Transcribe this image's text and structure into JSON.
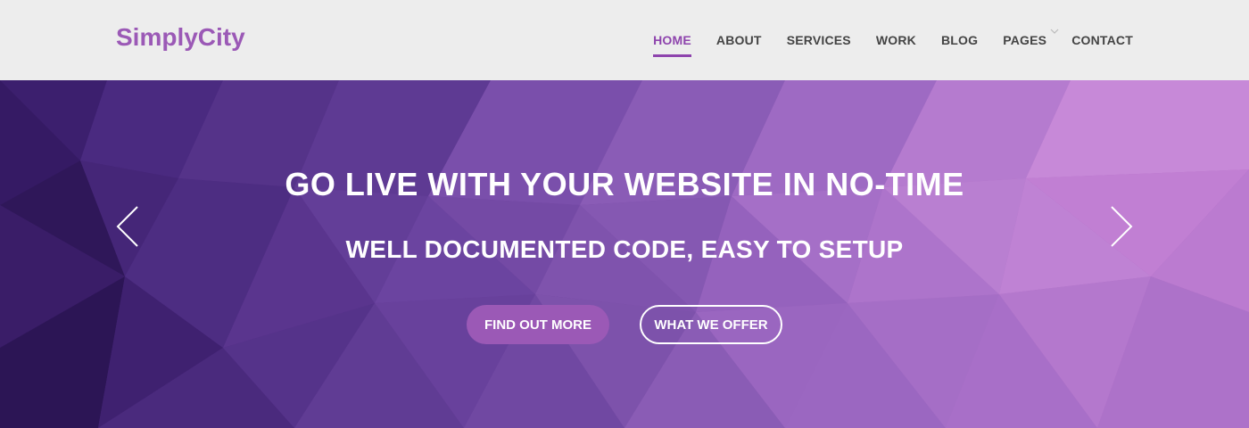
{
  "brand": {
    "name": "SimplyCity"
  },
  "nav": {
    "items": [
      {
        "label": "HOME",
        "active": true
      },
      {
        "label": "ABOUT"
      },
      {
        "label": "SERVICES"
      },
      {
        "label": "WORK"
      },
      {
        "label": "BLOG"
      },
      {
        "label": "PAGES",
        "has_dropdown": true
      },
      {
        "label": "CONTACT"
      }
    ]
  },
  "hero": {
    "headline": "GO LIVE WITH YOUR WEBSITE IN NO-TIME",
    "subheadline": "WELL DOCUMENTED CODE, EASY TO SETUP",
    "primary_button": "FIND OUT MORE",
    "secondary_button": "WHAT WE OFFER",
    "prev_icon": "chevron-left-icon",
    "next_icon": "chevron-right-icon"
  },
  "colors": {
    "accent": "#9b59b6",
    "nav_background": "#ededed",
    "nav_text": "#444444",
    "hero_dark": "#3a1d6b",
    "hero_light": "#c07bd3"
  }
}
